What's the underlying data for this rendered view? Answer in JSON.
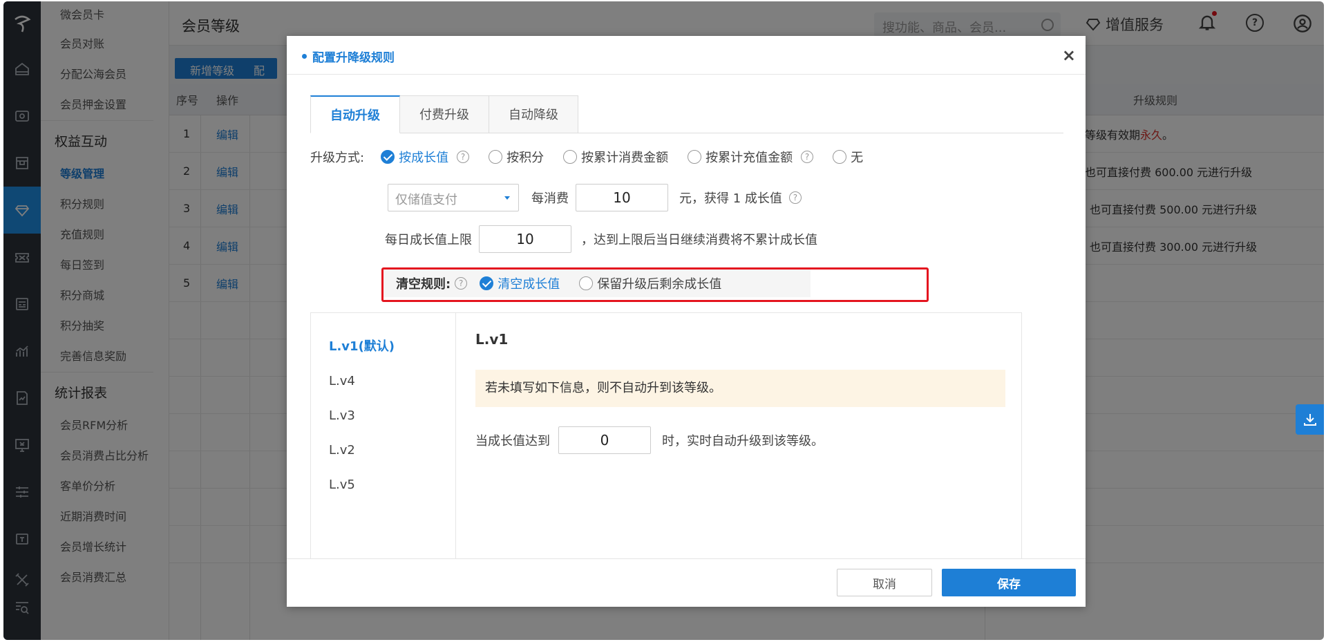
{
  "rail": {
    "icons": [
      "home-icon",
      "wallet-icon",
      "store-icon",
      "diamond-icon",
      "ticket-icon",
      "id-card-icon",
      "chart-icon",
      "report-icon",
      "money-screen-icon",
      "sliders-icon",
      "coupon-icon",
      "tools-icon",
      "search-menu-icon"
    ]
  },
  "subnav": {
    "group0_items": [
      "微会员卡",
      "会员对账",
      "分配公海会员",
      "会员押金设置"
    ],
    "group1_title": "权益互动",
    "group1_items": [
      "等级管理",
      "积分规则",
      "充值规则",
      "每日签到",
      "积分商城",
      "积分抽奖",
      "完善信息奖励"
    ],
    "group2_title": "统计报表",
    "group2_items": [
      "会员RFM分析",
      "会员消费占比分析",
      "客单价分析",
      "近期消费时间",
      "会员增长统计",
      "会员消费汇总"
    ]
  },
  "header": {
    "title": "会员等级",
    "search_placeholder": "搜功能、商品、会员...",
    "vas_label": "增值服务"
  },
  "toolbar": {
    "add_level": "新增等级",
    "config": "配"
  },
  "table": {
    "headers": {
      "idx": "序号",
      "op": "操作",
      "rule": "升级规则"
    },
    "rows": [
      {
        "idx": "1",
        "op": "编辑",
        "rule_prefix": "等级有效期 ",
        "rule_red": "永久",
        "rule_suffix": "。"
      },
      {
        "idx": "2",
        "op": "编辑",
        "rule_prefix": "也可直接付费 600.00 元进行升级",
        "rule_red": "",
        "rule_suffix": ""
      },
      {
        "idx": "3",
        "op": "编辑",
        "rule_prefix": "也可直接付费 500.00 元进行升级",
        "rule_red": "",
        "rule_suffix": ""
      },
      {
        "idx": "4",
        "op": "编辑",
        "rule_prefix": "也可直接付费 300.00 元进行升级",
        "rule_red": "",
        "rule_suffix": ""
      },
      {
        "idx": "5",
        "op": "编辑",
        "rule_prefix": "",
        "rule_red": "",
        "rule_suffix": ""
      }
    ]
  },
  "modal": {
    "title": "配置升降级规则",
    "close": "×",
    "tabs": [
      "自动升级",
      "付费升级",
      "自动降级"
    ],
    "method_label": "升级方式:",
    "methods": [
      {
        "label": "按成长值",
        "checked": true,
        "help": true
      },
      {
        "label": "按积分",
        "checked": false,
        "help": false
      },
      {
        "label": "按累计消费金额",
        "checked": false,
        "help": false
      },
      {
        "label": "按累计充值金额",
        "checked": false,
        "help": true
      },
      {
        "label": "无",
        "checked": false,
        "help": false
      }
    ],
    "pay_select": "仅储值支付",
    "per_spend_label": "每消费",
    "per_spend_value": "10",
    "gain_label": "元，获得 1 成长值",
    "daily_cap_label": "每日成长值上限",
    "daily_cap_value": "10",
    "daily_cap_note": "，达到上限后当日继续消费将不累计成长值",
    "clear_label": "清空规则:",
    "clear_options": [
      {
        "label": "清空成长值",
        "checked": true
      },
      {
        "label": "保留升级后剩余成长值",
        "checked": false
      }
    ],
    "levels": [
      "L.v1(默认)",
      "L.v4",
      "L.v3",
      "L.v2",
      "L.v5"
    ],
    "level_title": "L.v1",
    "notice": "若未填写如下信息，则不自动升到该等级。",
    "reach_label": "当成长值达到",
    "reach_value": "0",
    "reach_suffix": "时，实时自动升级到该等级。",
    "cancel": "取消",
    "save": "保存"
  }
}
